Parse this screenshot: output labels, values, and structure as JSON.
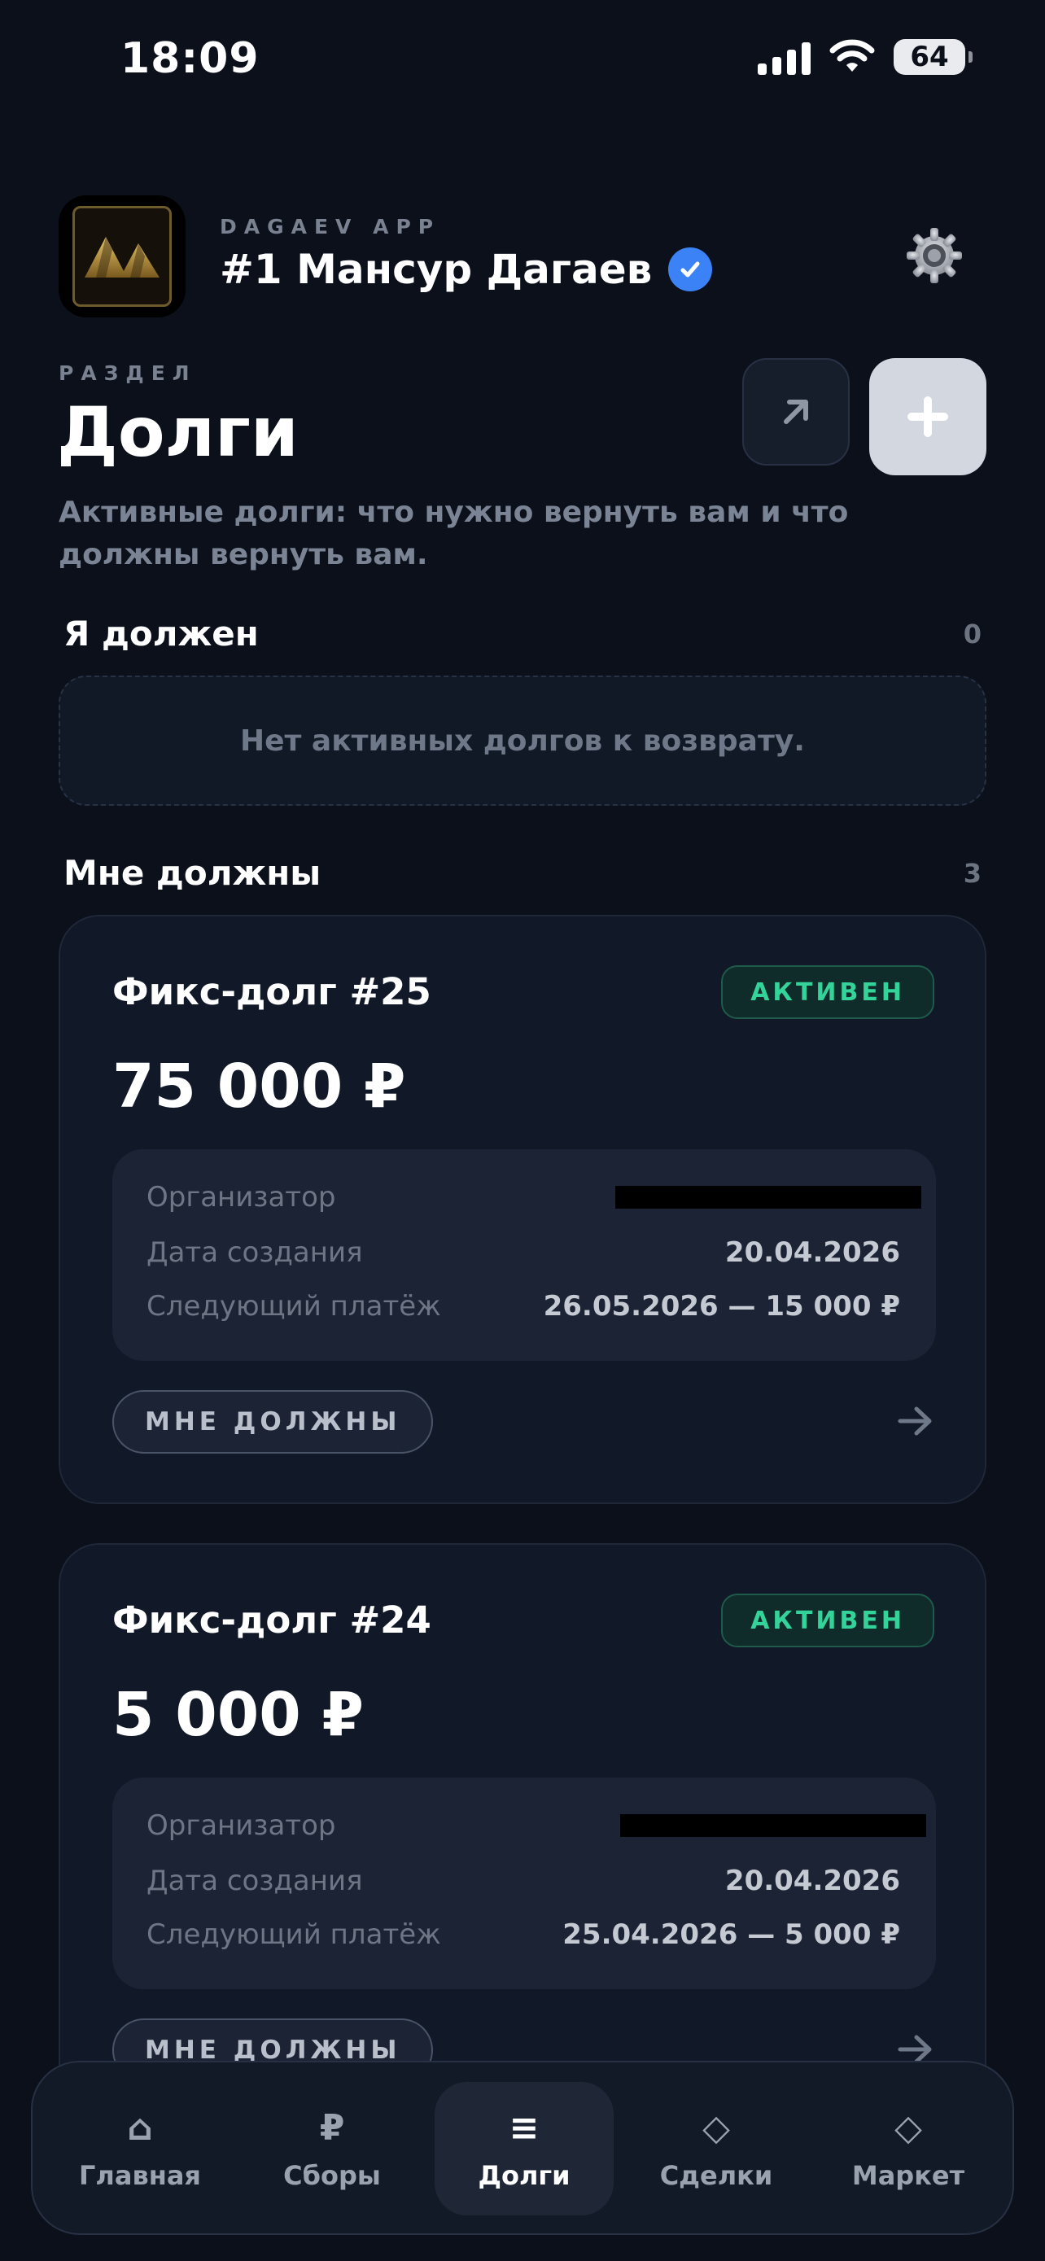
{
  "status_bar": {
    "time": "18:09",
    "battery": "64"
  },
  "header": {
    "app_caption": "DAGAEV APP",
    "user_name": "#1 Мансур Дагаев",
    "settings_icon": "gear-icon"
  },
  "page": {
    "section_caption": "РАЗДЕЛ",
    "title": "Долги",
    "description": "Активные долги: что нужно вернуть вам и что должны вернуть вам."
  },
  "i_owe": {
    "title": "Я должен",
    "count": "0",
    "empty_text": "Нет активных долгов к возврату."
  },
  "owed_to_me": {
    "title": "Мне должны",
    "count": "3",
    "cards": [
      {
        "title": "Фикс-долг #25",
        "status": "АКТИВЕН",
        "amount": "75 000 ₽",
        "rows": [
          {
            "label": "Организатор",
            "value": ""
          },
          {
            "label": "Дата создания",
            "value": "20.04.2026"
          },
          {
            "label": "Следующий платёж",
            "value": "26.05.2026 — 15 000 ₽"
          }
        ],
        "tag": "МНЕ ДОЛЖНЫ"
      },
      {
        "title": "Фикс-долг #24",
        "status": "АКТИВЕН",
        "amount": "5 000 ₽",
        "rows": [
          {
            "label": "Организатор",
            "value": ""
          },
          {
            "label": "Дата создания",
            "value": "20.04.2026"
          },
          {
            "label": "Следующий платёж",
            "value": "25.04.2026 — 5 000 ₽"
          }
        ],
        "tag": "МНЕ ДОЛЖНЫ"
      }
    ]
  },
  "tabbar": {
    "active": "Долги",
    "tabs": [
      {
        "label": "Главная",
        "icon": "⌂"
      },
      {
        "label": "Сборы",
        "icon": "₽"
      },
      {
        "label": "Долги",
        "icon": "≡"
      },
      {
        "label": "Сделки",
        "icon": "◇"
      },
      {
        "label": "Маркет",
        "icon": "◇"
      }
    ]
  },
  "colors": {
    "background": "#0b101b",
    "card": "#111827",
    "accent_green": "#34d399",
    "verified_blue": "#3b82f6"
  }
}
